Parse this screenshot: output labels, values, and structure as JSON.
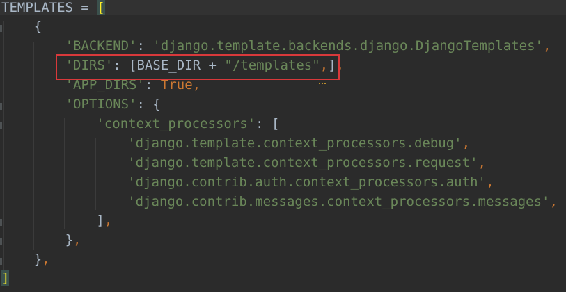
{
  "editor": {
    "language": "python",
    "lines": [
      {
        "indent": "",
        "tokens": [
          {
            "t": "TEMPLATES",
            "c": "plain"
          },
          {
            "t": " = ",
            "c": "plain"
          },
          {
            "t": "[",
            "c": "bracket-hl"
          }
        ]
      },
      {
        "indent": "    ",
        "tokens": [
          {
            "t": "{",
            "c": "plain"
          }
        ]
      },
      {
        "indent": "        ",
        "tokens": [
          {
            "t": "'BACKEND'",
            "c": "str"
          },
          {
            "t": ": ",
            "c": "plain"
          },
          {
            "t": "'django.template.backends.django.DjangoTemplates'",
            "c": "str"
          },
          {
            "t": ",",
            "c": "punc"
          }
        ]
      },
      {
        "indent": "        ",
        "tokens": [
          {
            "t": "'DIRS'",
            "c": "str"
          },
          {
            "t": ": [BASE_DIR + ",
            "c": "plain"
          },
          {
            "t": "\"/templates\"",
            "c": "str"
          },
          {
            "t": ",",
            "c": "punc"
          },
          {
            "t": "]",
            "c": "plain"
          },
          {
            "t": ",",
            "c": "punc"
          }
        ]
      },
      {
        "indent": "        ",
        "tokens": [
          {
            "t": "'APP_DIRS'",
            "c": "str"
          },
          {
            "t": ": ",
            "c": "plain"
          },
          {
            "t": "True",
            "c": "kw"
          },
          {
            "t": ",",
            "c": "punc"
          }
        ]
      },
      {
        "indent": "        ",
        "tokens": [
          {
            "t": "'OPTIONS'",
            "c": "str"
          },
          {
            "t": ": {",
            "c": "plain"
          }
        ]
      },
      {
        "indent": "            ",
        "tokens": [
          {
            "t": "'context_processors'",
            "c": "str"
          },
          {
            "t": ": [",
            "c": "plain"
          }
        ]
      },
      {
        "indent": "                ",
        "tokens": [
          {
            "t": "'django.template.context_processors.debug'",
            "c": "str"
          },
          {
            "t": ",",
            "c": "punc"
          }
        ]
      },
      {
        "indent": "                ",
        "tokens": [
          {
            "t": "'django.template.context_processors.request'",
            "c": "str"
          },
          {
            "t": ",",
            "c": "punc"
          }
        ]
      },
      {
        "indent": "                ",
        "tokens": [
          {
            "t": "'django.contrib.auth.context_processors.auth'",
            "c": "str"
          },
          {
            "t": ",",
            "c": "punc"
          }
        ]
      },
      {
        "indent": "                ",
        "tokens": [
          {
            "t": "'django.contrib.messages.context_processors.messages'",
            "c": "str"
          },
          {
            "t": ",",
            "c": "punc"
          }
        ]
      },
      {
        "indent": "            ",
        "tokens": [
          {
            "t": "]",
            "c": "plain"
          },
          {
            "t": ",",
            "c": "punc"
          }
        ]
      },
      {
        "indent": "        ",
        "tokens": [
          {
            "t": "}",
            "c": "plain"
          },
          {
            "t": ",",
            "c": "punc"
          }
        ]
      },
      {
        "indent": "    ",
        "tokens": [
          {
            "t": "}",
            "c": "plain"
          },
          {
            "t": ",",
            "c": "punc"
          }
        ]
      },
      {
        "indent": "",
        "tokens": [
          {
            "t": "]",
            "c": "bracket-hl-bottom"
          }
        ]
      }
    ]
  },
  "colors": {
    "background": "#2b2b2b",
    "string": "#6a8759",
    "keyword": "#cc7832",
    "text": "#a9b7c6",
    "highlight_box": "#d9393b",
    "bracket_match": "#ffef28"
  }
}
